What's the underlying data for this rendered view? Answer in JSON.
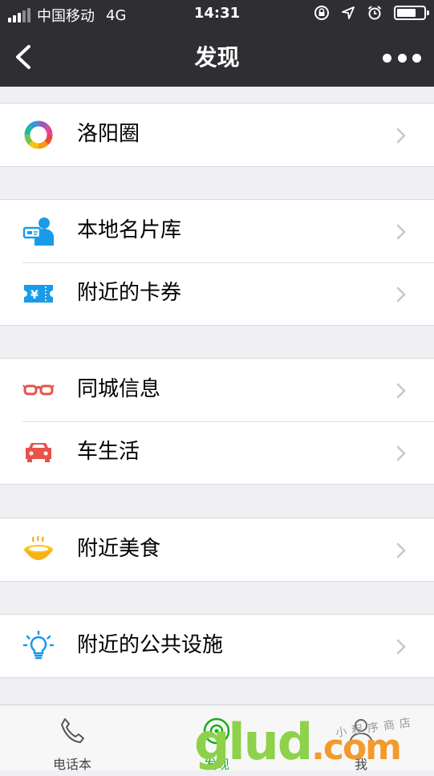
{
  "status_bar": {
    "carrier": "中国移动",
    "network": "4G",
    "time": "14:31",
    "battery_level": 0.64
  },
  "nav": {
    "title": "发现",
    "back_icon": "chevron-left-icon",
    "more_icon": "more-dots-icon"
  },
  "groups": [
    {
      "items": [
        {
          "label": "洛阳圈",
          "icon": "colorful-ring-icon"
        }
      ]
    },
    {
      "items": [
        {
          "label": "本地名片库",
          "icon": "business-card-icon"
        },
        {
          "label": "附近的卡券",
          "icon": "coupon-icon"
        }
      ]
    },
    {
      "items": [
        {
          "label": "同城信息",
          "icon": "glasses-icon"
        },
        {
          "label": "车生活",
          "icon": "car-icon"
        }
      ]
    },
    {
      "items": [
        {
          "label": "附近美食",
          "icon": "food-bowl-icon"
        }
      ]
    },
    {
      "items": [
        {
          "label": "附近的公共设施",
          "icon": "lightbulb-icon"
        }
      ]
    }
  ],
  "tabbar": {
    "tabs": [
      {
        "label": "电话本",
        "icon": "phone-icon",
        "active": false
      },
      {
        "label": "发现",
        "icon": "compass-icon",
        "active": true
      },
      {
        "label": "我",
        "icon": "person-icon",
        "active": false
      }
    ]
  },
  "watermark": {
    "text": "glud",
    "suffix": ".com",
    "subtext": "小程序商店"
  },
  "colors": {
    "header_bg": "#2f2f33",
    "page_bg": "#efeff4",
    "accent_green": "#1aad19"
  }
}
